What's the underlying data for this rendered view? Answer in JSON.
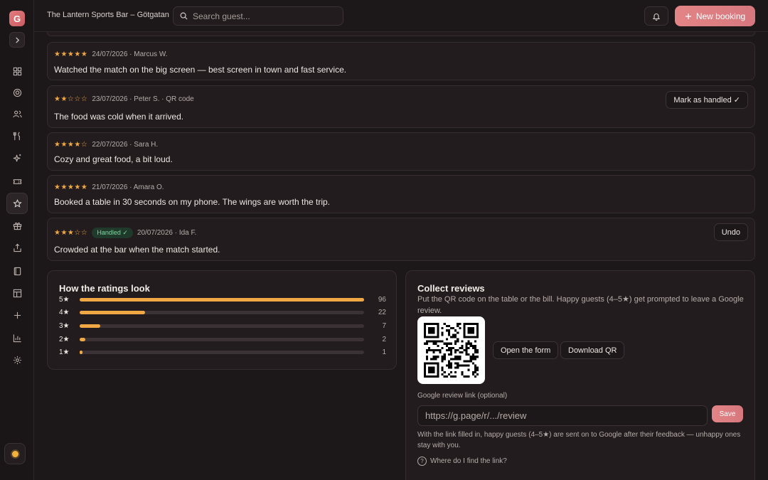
{
  "app": {
    "logo_letter": "G",
    "venue_name": "The Lantern Sports Bar – Götgatan"
  },
  "search": {
    "placeholder": "Search guest..."
  },
  "header": {
    "new_booking_label": "New booking"
  },
  "sidebar": {
    "items": [
      {
        "icon": "dashboard-icon"
      },
      {
        "icon": "soccer-ball-icon"
      },
      {
        "icon": "users-icon"
      },
      {
        "icon": "utensils-icon"
      },
      {
        "icon": "sparkles-icon"
      },
      {
        "icon": "ticket-icon"
      },
      {
        "icon": "star-icon",
        "active": true
      },
      {
        "icon": "gift-icon"
      },
      {
        "icon": "share-icon"
      },
      {
        "icon": "book-icon"
      },
      {
        "icon": "layout-icon"
      },
      {
        "icon": "plus-icon"
      },
      {
        "icon": "bar-chart-icon"
      },
      {
        "icon": "settings-icon"
      }
    ]
  },
  "reviews": [
    {
      "rating": 5,
      "stars": "★★★★★",
      "date": "24/07/2026",
      "author": "Marcus W.",
      "meta": "24/07/2026 · Marcus W.",
      "text": "Watched the match on the big screen — best screen in town and fast service."
    },
    {
      "rating": 2,
      "stars": "★★☆☆☆",
      "date": "23/07/2026",
      "author": "Peter S.",
      "meta": "23/07/2026 · Peter S. · QR code",
      "text": "The food was cold when it arrived.",
      "action": "Mark as handled ✓"
    },
    {
      "rating": 4,
      "stars": "★★★★☆",
      "date": "22/07/2026",
      "author": "Sara H.",
      "meta": "22/07/2026 · Sara H.",
      "text": "Cozy and great food, a bit loud."
    },
    {
      "rating": 5,
      "stars": "★★★★★",
      "date": "21/07/2026",
      "author": "Amara O.",
      "meta": "21/07/2026 · Amara O.",
      "text": "Booked a table in 30 seconds on my phone. The wings are worth the trip."
    },
    {
      "rating": 3,
      "stars": "★★★☆☆",
      "date": "20/07/2026",
      "author": "Ida F.",
      "meta": "20/07/2026 · Ida F.",
      "badge": "Handled ✓",
      "text": "Crowded at the bar when the match started.",
      "action": "Undo"
    }
  ],
  "ratings_panel": {
    "title": "How the ratings look",
    "rows": [
      {
        "label": "5★",
        "count": 96,
        "count_text": "96"
      },
      {
        "label": "4★",
        "count": 22,
        "count_text": "22"
      },
      {
        "label": "3★",
        "count": 7,
        "count_text": "7"
      },
      {
        "label": "2★",
        "count": 2,
        "count_text": "2"
      },
      {
        "label": "1★",
        "count": 1,
        "count_text": "1"
      }
    ]
  },
  "collect_panel": {
    "title": "Collect reviews",
    "description": "Put the QR code on the table or the bill. Happy guests (4–5★) get prompted to leave a Google review.",
    "open_form_label": "Open the form",
    "download_qr_label": "Download QR",
    "link_label": "Google review link (optional)",
    "link_placeholder": "https://g.page/r/.../review",
    "save_label": "Save",
    "hint": "With the link filled in, happy guests (4–5★) are sent on to Google after their feedback — unhappy ones stay with you.",
    "help_label": "Where do I find the link?"
  },
  "colors": {
    "accent": "#e38586",
    "star": "#f0a845",
    "success": "#7fd6a0"
  }
}
